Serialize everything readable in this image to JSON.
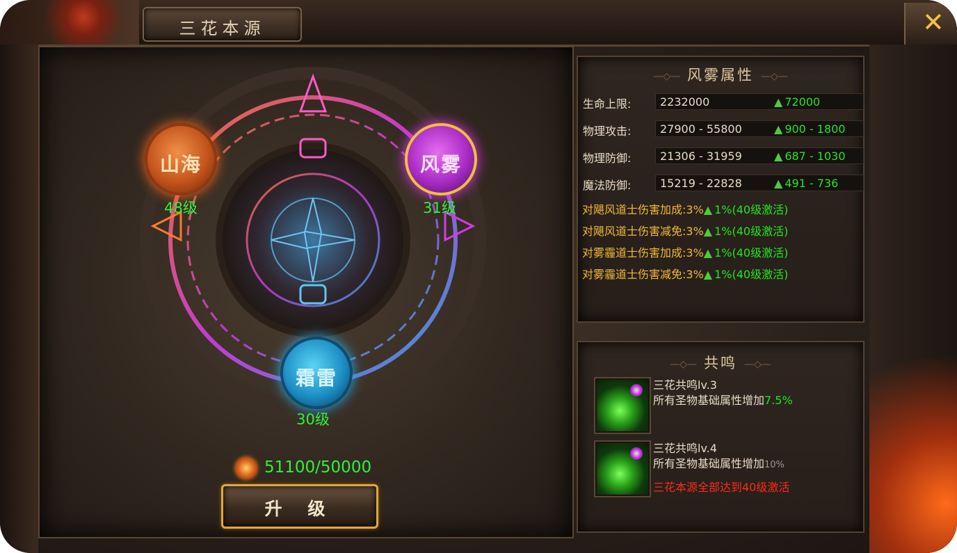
{
  "window": {
    "title": "三花本源",
    "close_icon": "close-x-icon"
  },
  "core": {
    "nodes": [
      {
        "key": "shanhai",
        "label": "山海",
        "level": "48级",
        "color": "#d9621e"
      },
      {
        "key": "fengwu",
        "label": "风雾",
        "level": "31级",
        "color": "#b833d6"
      },
      {
        "key": "shuanglei",
        "label": "霜雷",
        "level": "30级",
        "color": "#1e92c9"
      }
    ],
    "resource": {
      "amount": "51100/50000",
      "icon": "coin-icon"
    },
    "upgrade_label": "升 级"
  },
  "attributes": {
    "title": "风雾属性",
    "stats": [
      {
        "label": "生命上限:",
        "value": "2232000",
        "increase": "72000"
      },
      {
        "label": "物理攻击:",
        "value": "27900 - 55800",
        "increase": "900 - 1800"
      },
      {
        "label": "物理防御:",
        "value": "21306 - 31959",
        "increase": "687 - 1030"
      },
      {
        "label": "魔法防御:",
        "value": "15219 - 22828",
        "increase": "491 - 736"
      }
    ],
    "bonuses": [
      {
        "text": "对飓风道士伤害加成:3%",
        "up": "1%(40级激活)"
      },
      {
        "text": "对飓风道士伤害减免:3%",
        "up": "1%(40级激活)"
      },
      {
        "text": "对雾霾道士伤害加成:3%",
        "up": "1%(40级激活)"
      },
      {
        "text": "对雾霾道士伤害减免:3%",
        "up": "1%(40级激活)"
      }
    ]
  },
  "resonance": {
    "title": "共鸣",
    "items": [
      {
        "name": "三花共鸣lv.3",
        "desc": "所有圣物基础属性增加",
        "value": "7.5%",
        "note": ""
      },
      {
        "name": "三花共鸣lv.4",
        "desc": "所有圣物基础属性增加",
        "value": "10%",
        "note": "三花本源全部达到40级激活"
      }
    ]
  }
}
